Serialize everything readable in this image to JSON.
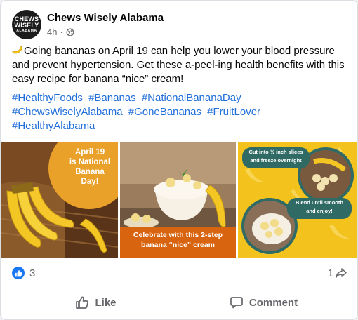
{
  "post": {
    "author": "Chews Wisely Alabama",
    "avatar_lines": [
      "CHEWS",
      "WISELY",
      "ALABAMA"
    ],
    "time": "4h",
    "separator": "·",
    "audience_icon": "globe-icon",
    "text": "Going bananas on April 19 can help you lower your blood pressure and prevent hypertension. Get these a-peel-ing health benefits with this easy recipe for banana “nice” cream!",
    "hashtags": [
      "#HealthyFoods",
      "#Bananas",
      "#NationalBananaDay",
      "#ChewsWiselyAlabama",
      "#GoneBananas",
      "#FruitLover",
      "#HealthyAlabama"
    ]
  },
  "images": {
    "panel1": {
      "badge_text": [
        "April 19",
        "is National",
        "Banana",
        "Day!"
      ]
    },
    "panel2": {
      "banner_text": [
        "Celebrate with this 2-step",
        "banana “nice” cream"
      ]
    },
    "panel3": {
      "step1": [
        "Cut into ½ inch slices",
        "and freeze overnight"
      ],
      "step2": [
        "Blend until smooth",
        "and enjoy!"
      ]
    }
  },
  "reactions": {
    "count": "3",
    "shares": "1",
    "icon": "like-icon"
  },
  "actions": {
    "like_label": "Like",
    "comment_label": "Comment"
  },
  "colors": {
    "accent_link": "#216fdb",
    "like_blue": "#1877f2",
    "muted": "#65676b",
    "badge_orange": "#e9a12a",
    "banner_orange": "#d9640f",
    "step_teal": "#2f6b64"
  }
}
